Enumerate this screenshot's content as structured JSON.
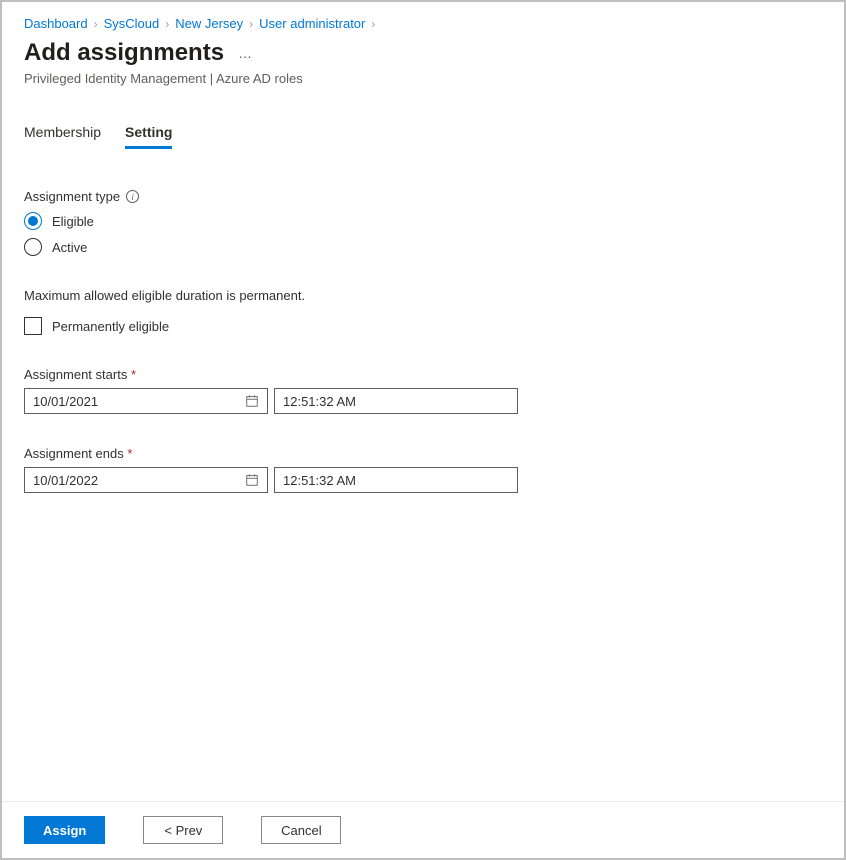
{
  "breadcrumb": {
    "items": [
      "Dashboard",
      "SysCloud",
      "New Jersey",
      "User administrator"
    ]
  },
  "page": {
    "title": "Add assignments",
    "subtitle": "Privileged Identity Management | Azure AD roles"
  },
  "tabs": {
    "membership": "Membership",
    "setting": "Setting"
  },
  "form": {
    "assignment_type_label": "Assignment type",
    "option_eligible": "Eligible",
    "option_active": "Active",
    "duration_note": "Maximum allowed eligible duration is permanent.",
    "permanently_eligible_label": "Permanently eligible",
    "starts_label": "Assignment starts",
    "ends_label": "Assignment ends",
    "start_date": "10/01/2021",
    "start_time": "12:51:32 AM",
    "end_date": "10/01/2022",
    "end_time": "12:51:32 AM"
  },
  "footer": {
    "assign": "Assign",
    "prev": "<  Prev",
    "cancel": "Cancel"
  }
}
